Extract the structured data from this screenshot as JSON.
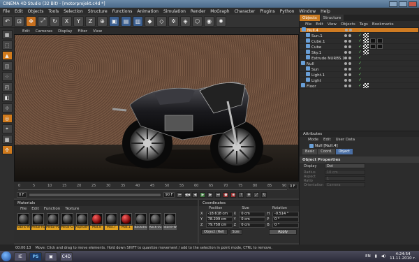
{
  "window": {
    "title": "CINEMA 4D Studio (32 Bit) - [motorprojekt.c4d *]"
  },
  "menu": [
    "File",
    "Edit",
    "Objects",
    "Tools",
    "Selection",
    "Structure",
    "Functions",
    "Animation",
    "Simulation",
    "Render",
    "MoGraph",
    "Character",
    "Plugins",
    "Python",
    "Window",
    "Help"
  ],
  "toolbar": {
    "icons": [
      "undo-icon",
      "live-select-icon",
      "move-icon",
      "scale-icon",
      "rotate-icon",
      "x-axis-icon",
      "y-axis-icon",
      "z-axis-icon",
      "coord-icon",
      "render-view-icon",
      "render-icon",
      "render-settings-icon",
      "cube-icon",
      "nurbs-icon",
      "array-icon",
      "deformer-icon",
      "scene-icon",
      "camera-icon",
      "light-icon"
    ],
    "glyphs": [
      "↶",
      "⊡",
      "✥",
      "⤢",
      "↻",
      "X",
      "Y",
      "Z",
      "⊕",
      "▣",
      "▤",
      "▥",
      "◆",
      "◇",
      "✲",
      "◈",
      "⬡",
      "◉",
      "✹"
    ]
  },
  "viewport": {
    "menu": [
      "Edit",
      "Cameras",
      "Display",
      "Filter",
      "View"
    ]
  },
  "timeline": {
    "ticks": [
      "0",
      "5",
      "10",
      "15",
      "20",
      "25",
      "30",
      "35",
      "40",
      "45",
      "50",
      "55",
      "60",
      "65",
      "70",
      "75",
      "80",
      "85",
      "90"
    ],
    "frame_end": "0 F",
    "start_field": "0 F",
    "end_field": "90 F"
  },
  "materials": {
    "title": "Materials",
    "menu": [
      "File",
      "Edit",
      "Function",
      "Texture"
    ],
    "items": [
      {
        "name": "Fabric-Ng",
        "red": false,
        "hl": true
      },
      {
        "name": "Metal-Ro",
        "red": false,
        "hl": true
      },
      {
        "name": "Metal-Po",
        "red": false,
        "hl": true
      },
      {
        "name": "Metal-Ch",
        "red": false,
        "hl": true
      },
      {
        "name": "Asphalt-K",
        "red": false,
        "hl": true
      },
      {
        "name": "Mat.8",
        "red": true,
        "hl": true
      },
      {
        "name": "Mat.7",
        "red": false,
        "hl": true
      },
      {
        "name": "Mat.1",
        "red": true,
        "hl": true
      },
      {
        "name": "Backdro",
        "red": false,
        "hl": false
      },
      {
        "name": "Rock-01",
        "red": false,
        "hl": false
      },
      {
        "name": "Stone-W",
        "red": false,
        "hl": false
      }
    ]
  },
  "coordinates": {
    "title": "Coordinates",
    "cols": [
      "Position",
      "Size",
      "Rotation"
    ],
    "rows": [
      {
        "ax": "X",
        "pos": "-18.618 cm",
        "sz_ax": "X",
        "size": "0 cm",
        "rot_ax": "H",
        "rot": "-0.514 °"
      },
      {
        "ax": "Y",
        "pos": "78.209 cm",
        "sz_ax": "Y",
        "size": "0 cm",
        "rot_ax": "P",
        "rot": "0 °"
      },
      {
        "ax": "Z",
        "pos": "79.758 cm",
        "sz_ax": "Z",
        "size": "0 cm",
        "rot_ax": "B",
        "rot": "0 °"
      }
    ],
    "mode": "Object (Rel)",
    "size_mode": "Size",
    "apply": "Apply"
  },
  "objects": {
    "tabs": [
      "Objects",
      "Structure"
    ],
    "menu": [
      "File",
      "Edit",
      "View",
      "Objects",
      "Tags",
      "Bookmarks"
    ],
    "rows": [
      {
        "name": "Null.4",
        "indent": 0,
        "selected": true,
        "tags": 0
      },
      {
        "name": "Sun.1",
        "indent": 1,
        "selected": false,
        "tags": 1
      },
      {
        "name": "Cube.1",
        "indent": 1,
        "selected": false,
        "tags": 3
      },
      {
        "name": "Cube",
        "indent": 1,
        "selected": false,
        "tags": 3
      },
      {
        "name": "Sky.1",
        "indent": 1,
        "selected": false,
        "tags": 1
      },
      {
        "name": "Extrude NURBS.1",
        "indent": 1,
        "selected": false,
        "tags": 0
      },
      {
        "name": "Null",
        "indent": 0,
        "selected": false,
        "tags": 0
      },
      {
        "name": "Sun",
        "indent": 1,
        "selected": false,
        "tags": 0
      },
      {
        "name": "Light.1",
        "indent": 1,
        "selected": false,
        "tags": 0
      },
      {
        "name": "Light",
        "indent": 1,
        "selected": false,
        "tags": 0
      },
      {
        "name": "Floor",
        "indent": 0,
        "selected": false,
        "tags": 1
      }
    ]
  },
  "attributes": {
    "title": "Attributes",
    "menu": [
      "Mode",
      "Edit",
      "User Data"
    ],
    "object_title": "Null [Null.4]",
    "tabs": [
      "Basic",
      "Coord.",
      "Object"
    ],
    "section": "Object Properties",
    "props": [
      {
        "label": "Display",
        "value": "Dot",
        "dim": false
      },
      {
        "label": "Radius",
        "value": "10 cm",
        "dim": true
      },
      {
        "label": "Aspect Ratio",
        "value": "1",
        "dim": true
      },
      {
        "label": "Orientation",
        "value": "Camera",
        "dim": true
      }
    ]
  },
  "status": {
    "time": "00:00:13",
    "message": "Move: Click and drag to move elements. Hold down SHIFT to quantize movement / add to the selection in point mode, CTRL to remove."
  },
  "taskbar": {
    "apps": [
      "IE",
      "PS",
      "▣",
      "C4D"
    ],
    "lang": "EN",
    "time": "4:24:54",
    "date": "11.11.2010 г."
  }
}
